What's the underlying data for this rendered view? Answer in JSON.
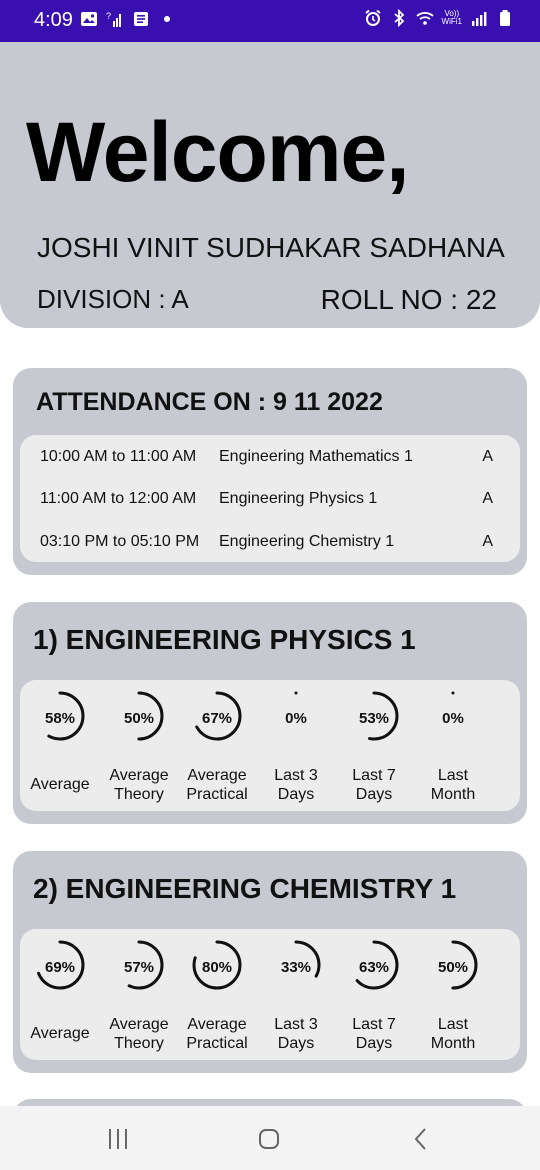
{
  "status_bar": {
    "time": "4:09",
    "left_icons": [
      "image-icon",
      "signal-question-icon",
      "document-icon",
      "dot-icon"
    ],
    "right_icons": [
      "alarm-icon",
      "bluetooth-icon",
      "wifi-icon",
      "signal-icon",
      "battery-icon"
    ],
    "volte_line1": "Vo))",
    "volte_line2": "WiFi1",
    "bar_color": "#3a0fb0"
  },
  "header": {
    "welcome": "Welcome,",
    "student_name": "JOSHI VINIT SUDHAKAR SADHANA",
    "division": "DIVISION  : A",
    "roll_no": "ROLL NO :  22"
  },
  "attendance": {
    "title": "ATTENDANCE ON :  9 11 2022",
    "rows": [
      {
        "time": "10:00 AM to 11:00 AM",
        "subject": "Engineering Mathematics 1",
        "mark": "A"
      },
      {
        "time": "11:00 AM to 12:00 AM",
        "subject": "Engineering Physics 1",
        "mark": "A"
      },
      {
        "time": "03:10 PM to 05:10 PM",
        "subject": "Engineering Chemistry 1",
        "mark": "A"
      }
    ]
  },
  "subjects": [
    {
      "title": "1) ENGINEERING PHYSICS 1",
      "stats": [
        {
          "pct": "58%",
          "value": 0.58,
          "label1": "Average",
          "label2": ""
        },
        {
          "pct": "50%",
          "value": 0.5,
          "label1": "Average",
          "label2": "Theory"
        },
        {
          "pct": "67%",
          "value": 0.67,
          "label1": "Average",
          "label2": "Practical"
        },
        {
          "pct": "0%",
          "value": 0.0,
          "label1": "Last 3",
          "label2": "Days"
        },
        {
          "pct": "53%",
          "value": 0.53,
          "label1": "Last 7",
          "label2": "Days"
        },
        {
          "pct": "0%",
          "value": 0.0,
          "label1": "Last",
          "label2": "Month"
        }
      ]
    },
    {
      "title": "2) ENGINEERING CHEMISTRY 1",
      "stats": [
        {
          "pct": "69%",
          "value": 0.69,
          "label1": "Average",
          "label2": ""
        },
        {
          "pct": "57%",
          "value": 0.57,
          "label1": "Average",
          "label2": "Theory"
        },
        {
          "pct": "80%",
          "value": 0.8,
          "label1": "Average",
          "label2": "Practical"
        },
        {
          "pct": "33%",
          "value": 0.33,
          "label1": "Last 3",
          "label2": "Days"
        },
        {
          "pct": "63%",
          "value": 0.63,
          "label1": "Last 7",
          "label2": "Days"
        },
        {
          "pct": "50%",
          "value": 0.5,
          "label1": "Last",
          "label2": "Month"
        }
      ]
    }
  ],
  "nav": {
    "buttons": [
      "recent-apps-icon",
      "home-icon",
      "back-icon"
    ]
  }
}
